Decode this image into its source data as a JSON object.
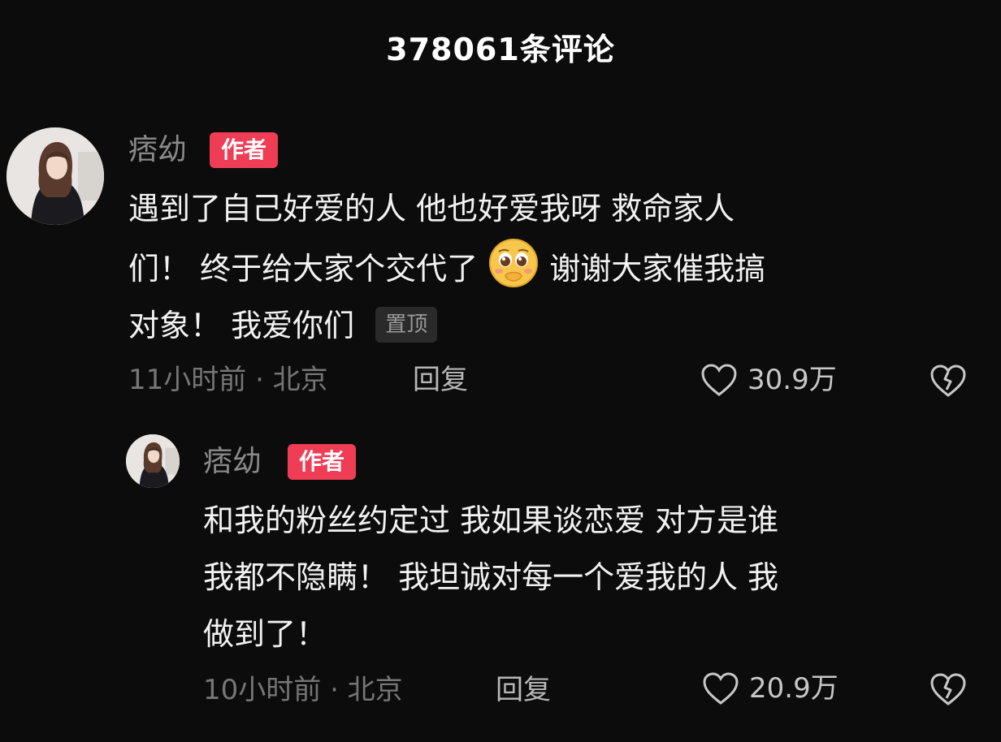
{
  "header": {
    "title": "378061条评论"
  },
  "comments": [
    {
      "username": "痞幼",
      "badge": "作者",
      "text_lines": [
        "遇到了自己好爱的人 他也好爱我呀 救命家人",
        "们！ 终于给大家个交代了",
        "谢谢大家催我搞",
        "对象！ 我爱你们"
      ],
      "pinned_label": "置顶",
      "emoji": "pleading-face-emoji",
      "time_location": "11小时前 · 北京",
      "reply_label": "回复",
      "like_count": "30.9万"
    },
    {
      "username": "痞幼",
      "badge": "作者",
      "text_lines": [
        "和我的粉丝约定过 我如果谈恋爱 对方是谁",
        "我都不隐瞒！ 我坦诚对每一个爱我的人 我",
        "做到了！"
      ],
      "time_location": "10小时前 · 北京",
      "reply_label": "回复",
      "like_count": "20.9万"
    }
  ],
  "icons": {
    "like": "heart-outline-icon",
    "dislike": "broken-heart-icon"
  },
  "colors": {
    "background": "#0c0c0c",
    "author_badge": "#ef3d56",
    "text": "#f2f2f2",
    "muted": "#767676"
  }
}
